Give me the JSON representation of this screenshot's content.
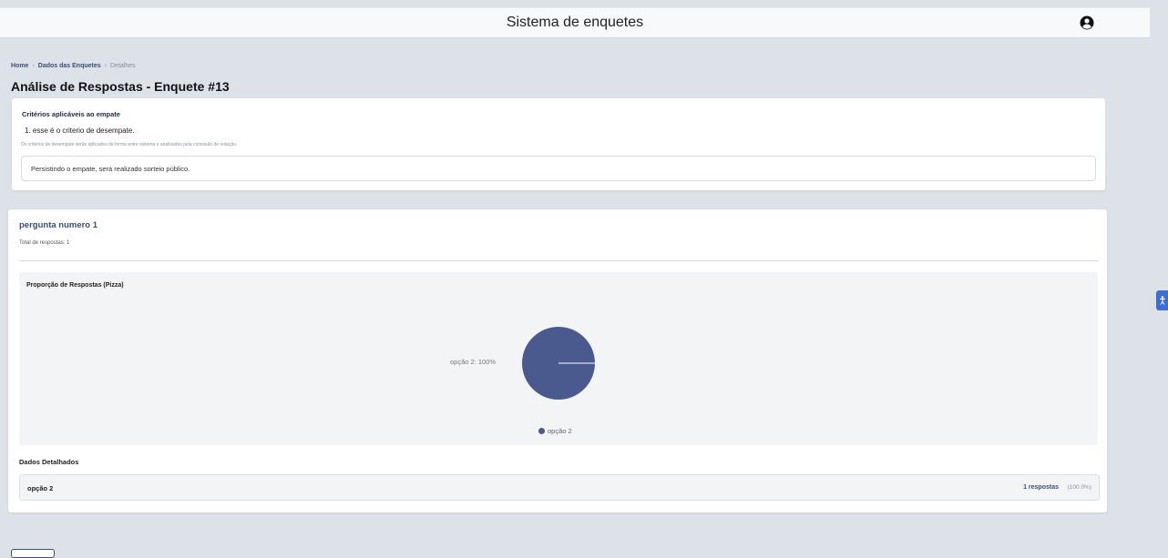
{
  "header": {
    "title": "Sistema de enquetes",
    "user_icon": "user-circle-icon"
  },
  "breadcrumb": {
    "items": [
      "Home",
      "Dados das Enquetes",
      "Detalhes"
    ],
    "separator": "›"
  },
  "page_title": "Análise de Respostas - Enquete #13",
  "criteria": {
    "title": "Critérios aplicáveis ao empate",
    "item": "1. esse é o criterio de desempate.",
    "note": "Os critérios de desempate serão aplicados de forma entre sistema e analisados pela comissão de votação.",
    "fallback": "Persistindo o empate, será realizado sorteio público."
  },
  "question": {
    "title": "pergunta numero 1",
    "total": "Total de respostas: 1",
    "chart_title": "Proporção de Respostas (Pizza)",
    "slice_label": "opção 2: 100%",
    "details_title": "Dados Detalhados",
    "rows": [
      {
        "option": "opção 2",
        "count": "1 respostas",
        "percent": "(100.0%)"
      }
    ]
  },
  "chart_data": {
    "type": "pie",
    "title": "Proporção de Respostas (Pizza)",
    "categories": [
      "opção 2"
    ],
    "values": [
      100
    ],
    "legend": [
      "opção 2"
    ],
    "legend_position": "bottom",
    "colors": [
      "#4a5a8f"
    ]
  }
}
